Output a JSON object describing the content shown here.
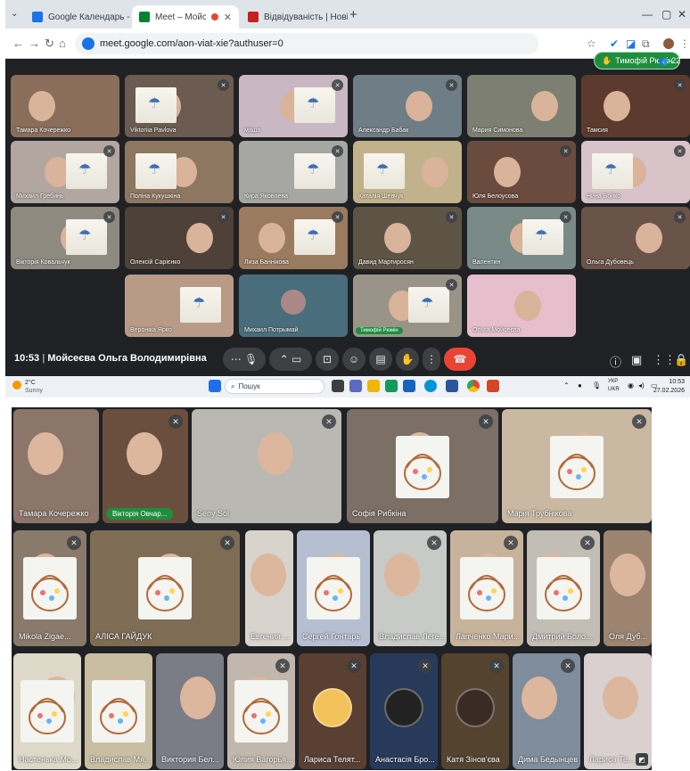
{
  "browser": {
    "tabs": [
      {
        "title": "Google Календарь - пятниця,",
        "favicon_color": "#1a73e8",
        "active": false
      },
      {
        "title": "Meet – Мойсеєва Ольга Во",
        "favicon_color": "#00832d",
        "active": true
      },
      {
        "title": "Відвідуваність | Нові знання",
        "favicon_color": "#c5221f",
        "active": false
      }
    ],
    "url": "meet.google.com/aon-viat-xie?authuser=0"
  },
  "meet_top": {
    "presenter_pill": "Тимофій Рюмін",
    "participant_count": "22",
    "tiles": [
      {
        "name": "Тамара Кочережко",
        "bg": "#8a6d5a"
      },
      {
        "name": "Viktoriia Pavlova",
        "bg": "#6b5b50"
      },
      {
        "name": "маша",
        "bg": "#c9b7c4"
      },
      {
        "name": "Александр Бабак",
        "bg": "#6f7d86"
      },
      {
        "name": "Мария Симонова",
        "bg": "#7c7f72"
      },
      {
        "name": "Тамсия",
        "bg": "#5c3b2e"
      },
      {
        "name": "Михаил Гребинь",
        "bg": "#b2a6a0"
      },
      {
        "name": "Поліна Кукушкіна",
        "bg": "#8d7760"
      },
      {
        "name": "Кира Яковлева",
        "bg": "#a6a7a2"
      },
      {
        "name": "Каталія Шевчук",
        "bg": "#c2b28c"
      },
      {
        "name": "Юля Белоусова",
        "bg": "#6b4b3e"
      },
      {
        "name": "Нина Бойко",
        "bg": "#d7c3c8"
      },
      {
        "name": "Вікторія Ковальчук",
        "bg": "#8f8a80"
      },
      {
        "name": "Олексій Сарієнко",
        "bg": "#4e4138"
      },
      {
        "name": "Лиза Баннікова",
        "bg": "#9b7b5f"
      },
      {
        "name": "Давид Мартиросян",
        "bg": "#5e5446"
      },
      {
        "name": "Валентин",
        "bg": "#7a8a86"
      },
      {
        "name": "Ольга Дубовець",
        "bg": "#6a5349"
      },
      {
        "name": "Вероніка Ярко",
        "bg": "#b89a86"
      },
      {
        "name": "Михаил Потрымай",
        "bg": "#4a6d7c"
      },
      {
        "name": "Тимофій Рюмін",
        "bg": "#9a9488"
      },
      {
        "name": "Ольга Мойсеєва",
        "bg": "#e7bfcc"
      }
    ],
    "time": "10:53",
    "meeting_title": "Мойсеєва Ольга Володимирівна"
  },
  "taskbar": {
    "temp": "2°C",
    "weather": "Sunny",
    "search": "Пошук",
    "lang": "УКР",
    "lang2": "UKR",
    "clock_time": "10:53",
    "clock_date": "27.02.2026"
  },
  "meet_bottom": {
    "tiles": [
      {
        "name": "Тамара Кочережко",
        "bg": "#8c7569"
      },
      {
        "name": "Вікторія Овчар...",
        "bg": "#6b4f3e"
      },
      {
        "name": "Seny Sol",
        "bg": "#b9b8b2"
      },
      {
        "name": "Софія Рибкіна",
        "bg": "#7b6f66"
      },
      {
        "name": "Марія Трубнікова",
        "bg": "#c9b8a2"
      },
      {
        "name": "Mikola Zigae...",
        "bg": "#8a7a6c"
      },
      {
        "name": "АЛІСА ГАЙДУК",
        "bg": "#7e6c55"
      },
      {
        "name": "Евгения ...",
        "bg": "#d8d3cc"
      },
      {
        "name": "Сергей Гонтарь",
        "bg": "#b6bfd2"
      },
      {
        "name": "Владислав Леге...",
        "bg": "#c8cac8"
      },
      {
        "name": "Лапченко Мари...",
        "bg": "#c7b39c"
      },
      {
        "name": "Дмитрий Боло...",
        "bg": "#c2bdb5"
      },
      {
        "name": "Оля Дуб...",
        "bg": "#9c8470"
      },
      {
        "name": "Настенька Мо...",
        "bg": "#ded8c8"
      },
      {
        "name": "Владислав Мя...",
        "bg": "#c9bea2"
      },
      {
        "name": "Виктория Бел...",
        "bg": "#7a7c86"
      },
      {
        "name": "Юлия Вагорья...",
        "bg": "#c2b7ac"
      },
      {
        "name": "Лариса Телят...",
        "bg": "#5a3f33"
      },
      {
        "name": "Анастасія Бро...",
        "bg": "#273a5a"
      },
      {
        "name": "Катя Зінов'єва",
        "bg": "#54432f"
      },
      {
        "name": "Дима Бедынцев",
        "bg": "#7f8d9c"
      },
      {
        "name": "Лариса Те...",
        "bg": "#d9d0cf"
      }
    ]
  }
}
